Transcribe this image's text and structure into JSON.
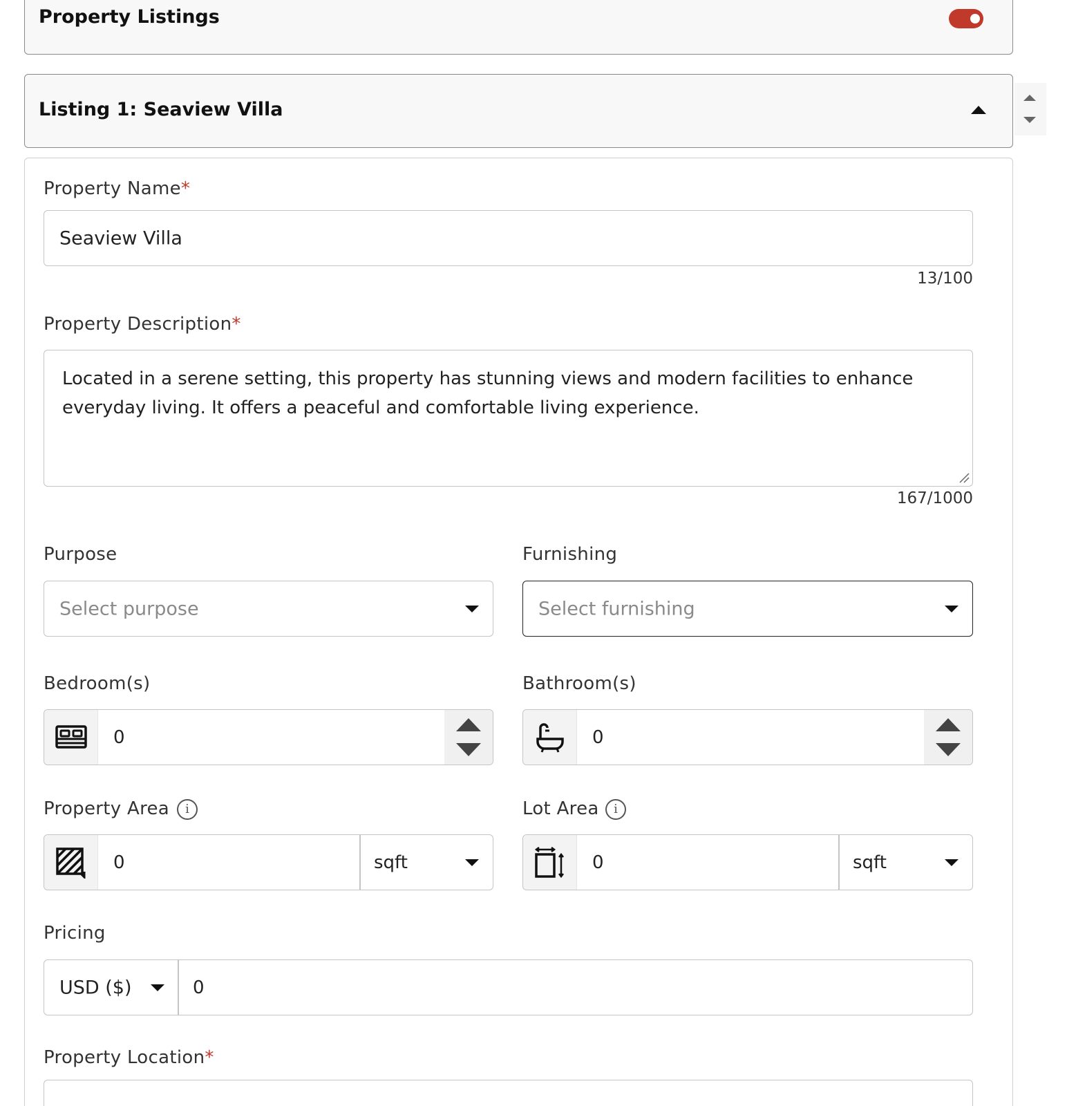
{
  "section": {
    "title": "Property Listings",
    "toggle_on": true,
    "toggle_color": "#c0392b"
  },
  "listing": {
    "header": "Listing 1: Seaview Villa",
    "expanded": true
  },
  "form": {
    "property_name": {
      "label": "Property Name",
      "required_mark": "*",
      "value": "Seaview Villa",
      "counter": "13/100"
    },
    "property_description": {
      "label": "Property Description",
      "required_mark": "*",
      "value": "Located in a serene setting, this property has stunning views and modern facilities to enhance everyday living. It offers a peaceful and comfortable living experience.",
      "counter": "167/1000"
    },
    "purpose": {
      "label": "Purpose",
      "placeholder": "Select purpose"
    },
    "furnishing": {
      "label": "Furnishing",
      "placeholder": "Select furnishing"
    },
    "bedrooms": {
      "label": "Bedroom(s)",
      "value": "0",
      "icon": "bed-icon"
    },
    "bathrooms": {
      "label": "Bathroom(s)",
      "value": "0",
      "icon": "bathtub-icon"
    },
    "property_area": {
      "label": "Property Area",
      "value": "0",
      "unit": "sqft",
      "icon": "area-hatch-icon"
    },
    "lot_area": {
      "label": "Lot Area",
      "value": "0",
      "unit": "sqft",
      "icon": "lot-dimension-icon"
    },
    "pricing": {
      "label": "Pricing",
      "currency": "USD ($)",
      "value": "0"
    },
    "property_location": {
      "label": "Property Location",
      "required_mark": "*"
    }
  }
}
